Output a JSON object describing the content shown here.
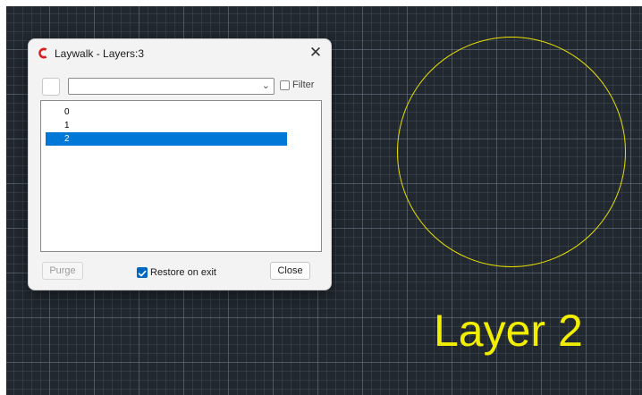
{
  "drawing": {
    "text_label": "Layer 2",
    "circle_color": "#e8e000",
    "background_color": "#212830"
  },
  "dialog": {
    "title": "Laywalk - Layers:3",
    "app_icon": "app-logo-icon",
    "close_glyph": "✕",
    "combo_value": "",
    "combo_arrow": "⌄",
    "filter_label": "Filter",
    "filter_checked": false,
    "layers": [
      "0",
      "1",
      "2"
    ],
    "selected_layer": "2",
    "purge_label": "Purge",
    "restore_label": "Restore on exit",
    "restore_checked": true,
    "close_label": "Close",
    "selection_color": "#0078d7"
  }
}
